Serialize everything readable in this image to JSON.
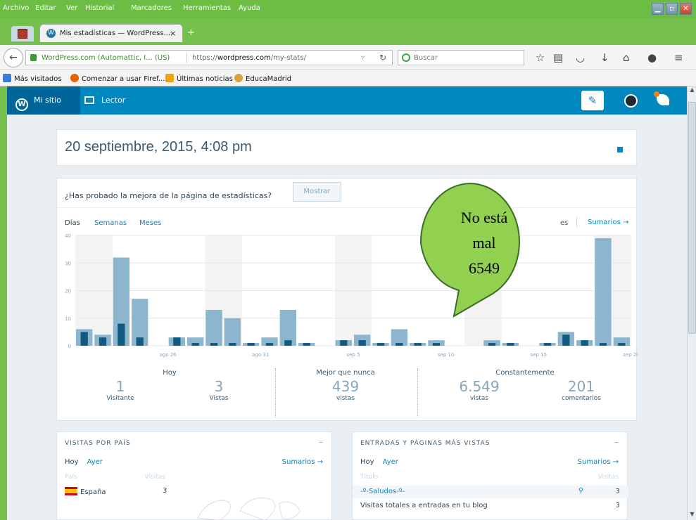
{
  "menu": [
    "Archivo",
    "Editar",
    "Ver",
    "Historial",
    "Marcadores",
    "Herramientas",
    "Ayuda"
  ],
  "browser": {
    "tab_title": "Mis estadísticas — WordPress...",
    "tab_close": "×",
    "new_tab": "+",
    "identity": "WordPress.com (Automattic, I... (US)",
    "url_prefix": "https://",
    "url_domain": "wordpress.com",
    "url_path": "/my-stats/",
    "search_placeholder": "Buscar",
    "bookmarks": [
      "Más visitados",
      "Comenzar a usar Firef...",
      "Últimas noticias",
      "EducaMadrid"
    ]
  },
  "wpbar": {
    "my_site": "Mi sitio",
    "reader": "Lector",
    "wp_logo_letter": "W"
  },
  "page": {
    "date": "20 septiembre, 2015, 4:08 pm"
  },
  "promo": {
    "text": "¿Has probado la mejora de la página de estadísticas?",
    "button": "Mostrar"
  },
  "periods": {
    "days": "Días",
    "weeks": "Semanas",
    "months": "Meses",
    "partial": "es",
    "summaries": "Sumarios →"
  },
  "chart_data": {
    "type": "bar",
    "ylim": [
      0,
      40
    ],
    "yticks": [
      "0",
      "10",
      "20",
      "30",
      "40"
    ],
    "xticks": [
      {
        "label": "ago 26",
        "index": 5
      },
      {
        "label": "ago 31",
        "index": 10
      },
      {
        "label": "sep 5",
        "index": 15
      },
      {
        "label": "sep 10",
        "index": 20
      },
      {
        "label": "sep 15",
        "index": 25
      },
      {
        "label": "sep 20",
        "index": 30
      }
    ],
    "series": [
      {
        "name": "Vistas",
        "color": "#8cb6cd",
        "values": [
          6,
          4,
          32,
          17,
          0,
          3,
          3,
          13,
          10,
          1,
          3,
          13,
          1,
          0,
          2,
          4,
          1,
          6,
          1,
          2,
          0,
          0,
          2,
          1,
          0,
          1,
          5,
          2,
          39,
          3
        ]
      },
      {
        "name": "Visitantes",
        "color": "#135a82",
        "values": [
          5,
          3,
          8,
          3,
          0,
          3,
          1,
          1,
          1,
          1,
          1,
          2,
          1,
          0,
          2,
          2,
          1,
          1,
          1,
          1,
          0,
          0,
          1,
          1,
          0,
          1,
          4,
          2,
          1,
          1
        ]
      }
    ],
    "weekend_shading": [
      [
        1,
        2
      ],
      [
        8,
        9
      ],
      [
        15,
        16
      ],
      [
        22,
        23
      ],
      [
        29,
        30
      ]
    ]
  },
  "stats": {
    "today": {
      "heading": "Hoy",
      "visitors_value": "1",
      "visitors_label": "Visitante",
      "views_value": "3",
      "views_label": "Vistas"
    },
    "best": {
      "heading": "Mejor que nunca",
      "value": "439",
      "label": "vistas"
    },
    "total": {
      "heading": "Constantemente",
      "views_value": "6.549",
      "views_label": "vistas",
      "comments_value": "201",
      "comments_label": "comentarios"
    }
  },
  "country_panel": {
    "title": "VISITAS POR PAÍS",
    "minimize": "–",
    "tab_today": "Hoy",
    "tab_yesterday": "Ayer",
    "summaries": "Sumarios →",
    "col_country": "País",
    "col_visits": "Visitas",
    "rows": [
      {
        "country": "España",
        "visits": "3"
      }
    ]
  },
  "posts_panel": {
    "title": "ENTRADAS Y PÁGINAS MÁS VISTAS",
    "minimize": "–",
    "tab_today": "Hoy",
    "tab_yesterday": "Ayer",
    "summaries": "Sumarios →",
    "col_title": "Título",
    "col_visits": "Visitas",
    "rows": [
      {
        "title": "-º-Saludos-º-",
        "visits": "3"
      },
      {
        "title": "Visitas totales a entradas en tu blog",
        "visits": "3"
      }
    ]
  },
  "callout": {
    "line1": "No está",
    "line2": "mal",
    "line3": "6549",
    "fill": "#92d050",
    "stroke": "#3d6b2a"
  }
}
